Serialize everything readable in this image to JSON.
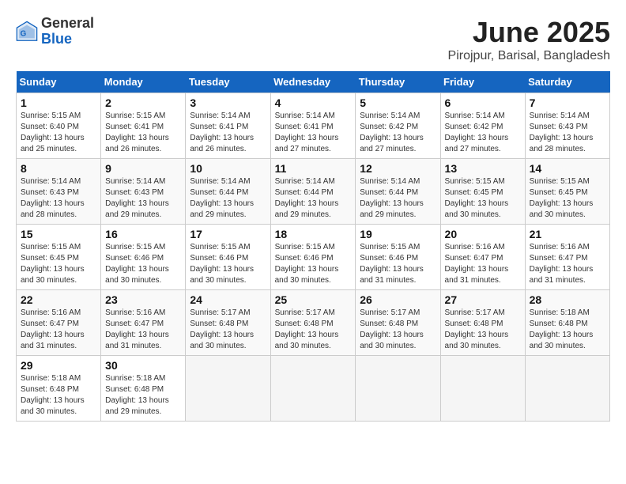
{
  "header": {
    "logo_general": "General",
    "logo_blue": "Blue",
    "month_year": "June 2025",
    "location": "Pirojpur, Barisal, Bangladesh"
  },
  "weekdays": [
    "Sunday",
    "Monday",
    "Tuesday",
    "Wednesday",
    "Thursday",
    "Friday",
    "Saturday"
  ],
  "weeks": [
    [
      {
        "day": "1",
        "details": [
          "Sunrise: 5:15 AM",
          "Sunset: 6:40 PM",
          "Daylight: 13 hours",
          "and 25 minutes."
        ]
      },
      {
        "day": "2",
        "details": [
          "Sunrise: 5:15 AM",
          "Sunset: 6:41 PM",
          "Daylight: 13 hours",
          "and 26 minutes."
        ]
      },
      {
        "day": "3",
        "details": [
          "Sunrise: 5:14 AM",
          "Sunset: 6:41 PM",
          "Daylight: 13 hours",
          "and 26 minutes."
        ]
      },
      {
        "day": "4",
        "details": [
          "Sunrise: 5:14 AM",
          "Sunset: 6:41 PM",
          "Daylight: 13 hours",
          "and 27 minutes."
        ]
      },
      {
        "day": "5",
        "details": [
          "Sunrise: 5:14 AM",
          "Sunset: 6:42 PM",
          "Daylight: 13 hours",
          "and 27 minutes."
        ]
      },
      {
        "day": "6",
        "details": [
          "Sunrise: 5:14 AM",
          "Sunset: 6:42 PM",
          "Daylight: 13 hours",
          "and 27 minutes."
        ]
      },
      {
        "day": "7",
        "details": [
          "Sunrise: 5:14 AM",
          "Sunset: 6:43 PM",
          "Daylight: 13 hours",
          "and 28 minutes."
        ]
      }
    ],
    [
      {
        "day": "8",
        "details": [
          "Sunrise: 5:14 AM",
          "Sunset: 6:43 PM",
          "Daylight: 13 hours",
          "and 28 minutes."
        ]
      },
      {
        "day": "9",
        "details": [
          "Sunrise: 5:14 AM",
          "Sunset: 6:43 PM",
          "Daylight: 13 hours",
          "and 29 minutes."
        ]
      },
      {
        "day": "10",
        "details": [
          "Sunrise: 5:14 AM",
          "Sunset: 6:44 PM",
          "Daylight: 13 hours",
          "and 29 minutes."
        ]
      },
      {
        "day": "11",
        "details": [
          "Sunrise: 5:14 AM",
          "Sunset: 6:44 PM",
          "Daylight: 13 hours",
          "and 29 minutes."
        ]
      },
      {
        "day": "12",
        "details": [
          "Sunrise: 5:14 AM",
          "Sunset: 6:44 PM",
          "Daylight: 13 hours",
          "and 29 minutes."
        ]
      },
      {
        "day": "13",
        "details": [
          "Sunrise: 5:15 AM",
          "Sunset: 6:45 PM",
          "Daylight: 13 hours",
          "and 30 minutes."
        ]
      },
      {
        "day": "14",
        "details": [
          "Sunrise: 5:15 AM",
          "Sunset: 6:45 PM",
          "Daylight: 13 hours",
          "and 30 minutes."
        ]
      }
    ],
    [
      {
        "day": "15",
        "details": [
          "Sunrise: 5:15 AM",
          "Sunset: 6:45 PM",
          "Daylight: 13 hours",
          "and 30 minutes."
        ]
      },
      {
        "day": "16",
        "details": [
          "Sunrise: 5:15 AM",
          "Sunset: 6:46 PM",
          "Daylight: 13 hours",
          "and 30 minutes."
        ]
      },
      {
        "day": "17",
        "details": [
          "Sunrise: 5:15 AM",
          "Sunset: 6:46 PM",
          "Daylight: 13 hours",
          "and 30 minutes."
        ]
      },
      {
        "day": "18",
        "details": [
          "Sunrise: 5:15 AM",
          "Sunset: 6:46 PM",
          "Daylight: 13 hours",
          "and 30 minutes."
        ]
      },
      {
        "day": "19",
        "details": [
          "Sunrise: 5:15 AM",
          "Sunset: 6:46 PM",
          "Daylight: 13 hours",
          "and 31 minutes."
        ]
      },
      {
        "day": "20",
        "details": [
          "Sunrise: 5:16 AM",
          "Sunset: 6:47 PM",
          "Daylight: 13 hours",
          "and 31 minutes."
        ]
      },
      {
        "day": "21",
        "details": [
          "Sunrise: 5:16 AM",
          "Sunset: 6:47 PM",
          "Daylight: 13 hours",
          "and 31 minutes."
        ]
      }
    ],
    [
      {
        "day": "22",
        "details": [
          "Sunrise: 5:16 AM",
          "Sunset: 6:47 PM",
          "Daylight: 13 hours",
          "and 31 minutes."
        ]
      },
      {
        "day": "23",
        "details": [
          "Sunrise: 5:16 AM",
          "Sunset: 6:47 PM",
          "Daylight: 13 hours",
          "and 31 minutes."
        ]
      },
      {
        "day": "24",
        "details": [
          "Sunrise: 5:17 AM",
          "Sunset: 6:48 PM",
          "Daylight: 13 hours",
          "and 30 minutes."
        ]
      },
      {
        "day": "25",
        "details": [
          "Sunrise: 5:17 AM",
          "Sunset: 6:48 PM",
          "Daylight: 13 hours",
          "and 30 minutes."
        ]
      },
      {
        "day": "26",
        "details": [
          "Sunrise: 5:17 AM",
          "Sunset: 6:48 PM",
          "Daylight: 13 hours",
          "and 30 minutes."
        ]
      },
      {
        "day": "27",
        "details": [
          "Sunrise: 5:17 AM",
          "Sunset: 6:48 PM",
          "Daylight: 13 hours",
          "and 30 minutes."
        ]
      },
      {
        "day": "28",
        "details": [
          "Sunrise: 5:18 AM",
          "Sunset: 6:48 PM",
          "Daylight: 13 hours",
          "and 30 minutes."
        ]
      }
    ],
    [
      {
        "day": "29",
        "details": [
          "Sunrise: 5:18 AM",
          "Sunset: 6:48 PM",
          "Daylight: 13 hours",
          "and 30 minutes."
        ]
      },
      {
        "day": "30",
        "details": [
          "Sunrise: 5:18 AM",
          "Sunset: 6:48 PM",
          "Daylight: 13 hours",
          "and 29 minutes."
        ]
      },
      null,
      null,
      null,
      null,
      null
    ]
  ]
}
